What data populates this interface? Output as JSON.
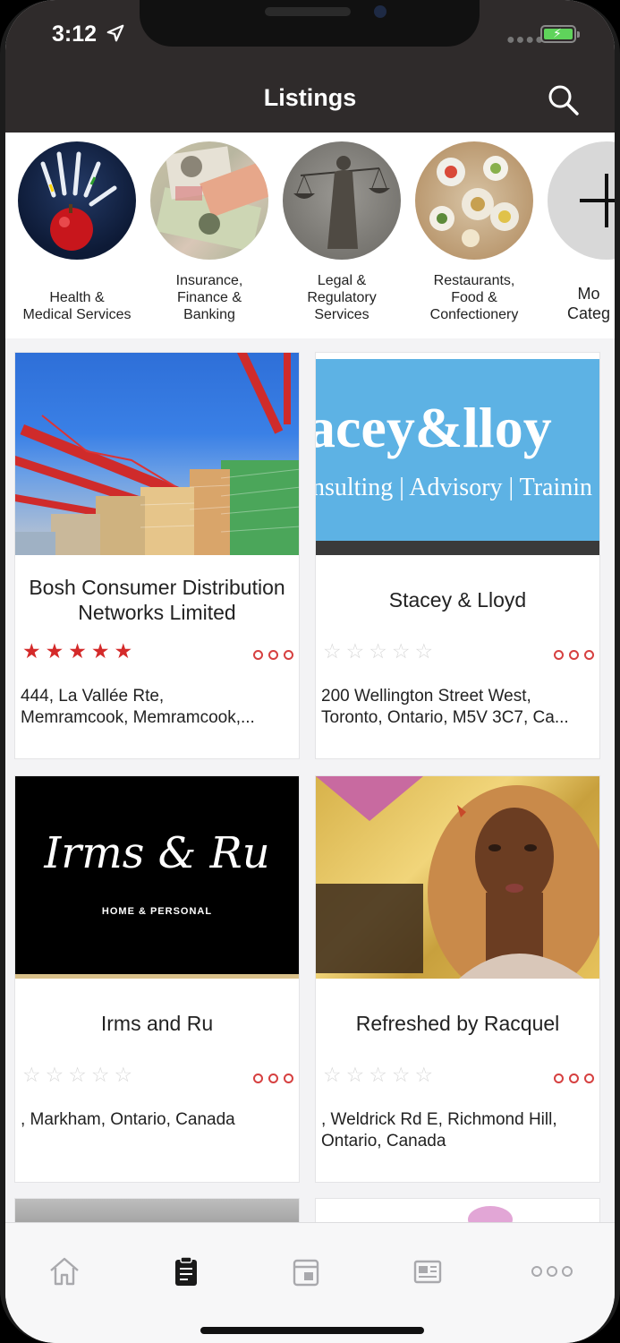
{
  "status_bar": {
    "time": "3:12"
  },
  "header": {
    "title": "Listings"
  },
  "categories": [
    {
      "label": "Health &\nMedical Services"
    },
    {
      "label": "Insurance,\nFinance &\nBanking"
    },
    {
      "label": "Legal &\nRegulatory\nServices"
    },
    {
      "label": "Restaurants,\nFood &\nConfectionery"
    },
    {
      "label": "Mo\nCateg"
    }
  ],
  "listings": [
    {
      "title": "Bosh Consumer Distribution Networks Limited",
      "rating": 5,
      "address": "444, La Vallée Rte,\nMemramcook, Memramcook,..."
    },
    {
      "title": "Stacey & Lloyd",
      "rating": 0,
      "address": "200 Wellington Street West,\nToronto, Ontario, M5V 3C7, Ca...",
      "image_text": {
        "main": "acey&lloy",
        "sub": "nsulting | Advisory | Trainin"
      }
    },
    {
      "title": "Irms and Ru",
      "rating": 0,
      "address": ", Markham, Ontario, Canada",
      "image_text": {
        "main": "Irms & Ru",
        "sub": "HOME & PERSONAL"
      }
    },
    {
      "title": "Refreshed by Racquel",
      "rating": 0,
      "address": ", Weldrick Rd E, Richmond Hill,\nOntario, Canada"
    }
  ],
  "tabbar": {
    "items": [
      "home-icon",
      "listings-icon",
      "calendar-icon",
      "news-icon",
      "more-icon"
    ],
    "active_index": 1
  },
  "colors": {
    "header_bg": "#2f2b2b",
    "star_active": "#d42a2a",
    "star_inactive": "#d8d8d8",
    "more_dots": "#d64040"
  }
}
